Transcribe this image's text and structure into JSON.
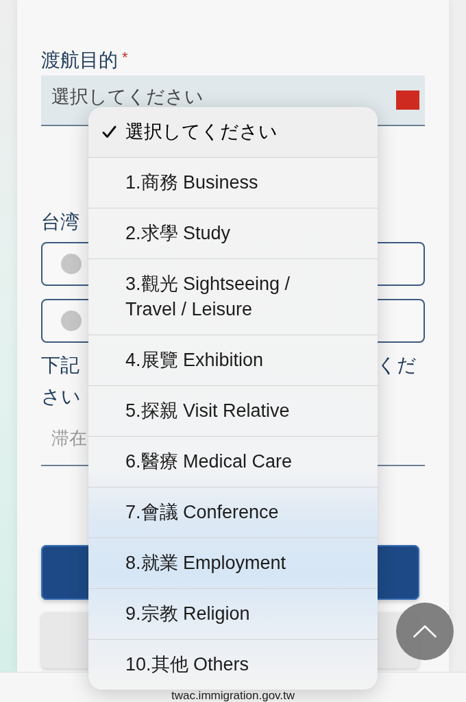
{
  "form": {
    "travel_purpose": {
      "label": "渡航目的",
      "required_mark": "*",
      "select": {
        "value": "選択してください"
      }
    },
    "residence_question": {
      "label": "台湾",
      "options": [
        {
          "selected": false
        },
        {
          "selected": false
        }
      ]
    },
    "notice": {
      "line_1_left": "下記",
      "line_1_right": "くだ",
      "line_2": "さい"
    },
    "stay_input": {
      "placeholder": "滞在"
    },
    "buttons": [
      {
        "kind": "primary"
      },
      {
        "kind": "secondary"
      }
    ]
  },
  "dropdown": {
    "options": [
      {
        "label": "選択してください",
        "selected": true
      },
      {
        "label": "1.商務 Business",
        "selected": false
      },
      {
        "label": "2.求學 Study",
        "selected": false
      },
      {
        "label": "3.觀光 Sightseeing / Travel / Leisure",
        "selected": false
      },
      {
        "label": "4.展覽 Exhibition",
        "selected": false
      },
      {
        "label": "5.探親 Visit Relative",
        "selected": false
      },
      {
        "label": "6.醫療 Medical Care",
        "selected": false
      },
      {
        "label": "7.會議 Conference",
        "selected": false
      },
      {
        "label": "8.就業 Employment",
        "selected": false
      },
      {
        "label": "9.宗教 Religion",
        "selected": false
      },
      {
        "label": "10.其他 Others",
        "selected": false
      }
    ]
  },
  "address_bar": {
    "url": "twac.immigration.gov.tw"
  }
}
